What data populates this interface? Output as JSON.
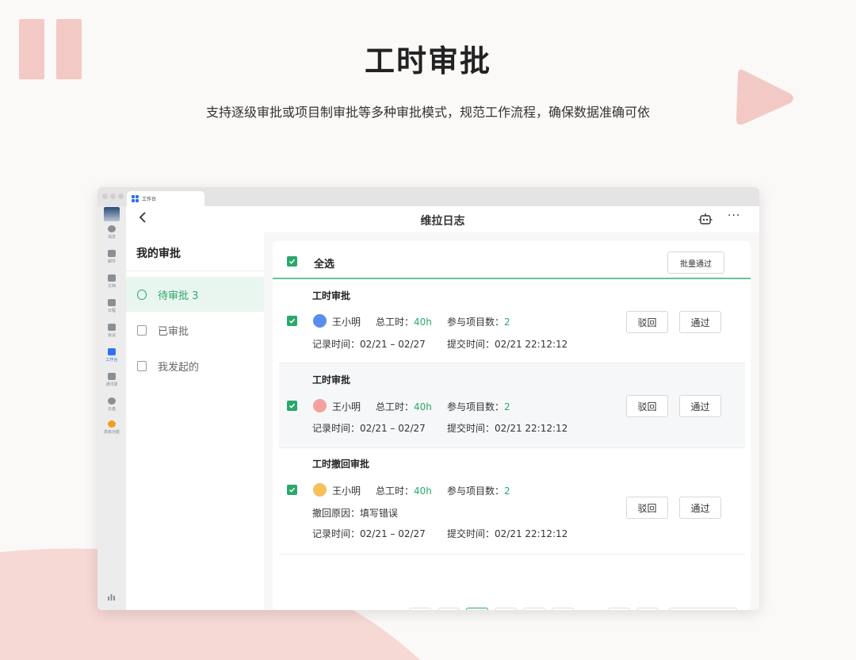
{
  "hero": {
    "title": "工时审批",
    "subtitle": "支持逐级审批或项目制审批等多种审批模式，规范工作流程，确保数据准确可依"
  },
  "colors": {
    "accent": "#2aa86b",
    "deco": "#f3c9c5"
  },
  "window": {
    "tab_label": "工作台",
    "rail": [
      {
        "label": "消息",
        "icon": "chat-icon"
      },
      {
        "label": "邮件",
        "icon": "mail-icon"
      },
      {
        "label": "文档",
        "icon": "doc-icon"
      },
      {
        "label": "日程",
        "icon": "calendar-icon"
      },
      {
        "label": "会议",
        "icon": "meeting-icon"
      },
      {
        "label": "工作台",
        "icon": "grid-icon",
        "active": true
      },
      {
        "label": "通讯录",
        "icon": "contacts-icon"
      },
      {
        "label": "云盘",
        "icon": "cloud-icon"
      },
      {
        "label": "高级功能",
        "icon": "premium-icon"
      }
    ]
  },
  "app": {
    "title": "维拉日志",
    "back_icon": "chevron-left-icon",
    "more_label": "···"
  },
  "sidebar": {
    "title": "我的审批",
    "items": [
      {
        "label": "待审批 3",
        "icon": "clock-icon",
        "active": true
      },
      {
        "label": "已审批",
        "icon": "doc-check-icon"
      },
      {
        "label": "我发起的",
        "icon": "doc-send-icon"
      }
    ]
  },
  "panel": {
    "select_all": "全选",
    "batch_approve": "批量通过",
    "cards": [
      {
        "title": "工时审批",
        "name": "王小明",
        "total_label": "总工时：",
        "total_value": "40h",
        "projects_label": "参与项目数：",
        "projects_value": "2",
        "record_time": "记录时间：02/21 – 02/27",
        "submit_time": "提交时间：02/21 22:12:12",
        "avatar_color": "#5b8def",
        "reject": "驳回",
        "approve": "通过"
      },
      {
        "title": "工时审批",
        "name": "王小明",
        "total_label": "总工时：",
        "total_value": "40h",
        "projects_label": "参与项目数：",
        "projects_value": "2",
        "record_time": "记录时间：02/21 – 02/27",
        "submit_time": "提交时间：02/21 22:12:12",
        "avatar_color": "#f5a0a0",
        "reject": "驳回",
        "approve": "通过"
      },
      {
        "title": "工时撤回审批",
        "name": "王小明",
        "total_label": "总工时：",
        "total_value": "40h",
        "projects_label": "参与项目数：",
        "projects_value": "2",
        "withdraw_reason": "撤回原因：填写错误",
        "record_time": "记录时间：02/21 – 02/27",
        "submit_time": "提交时间：02/21 22:12:12",
        "avatar_color": "#f7c05a",
        "reject": "驳回",
        "approve": "通过"
      }
    ]
  }
}
